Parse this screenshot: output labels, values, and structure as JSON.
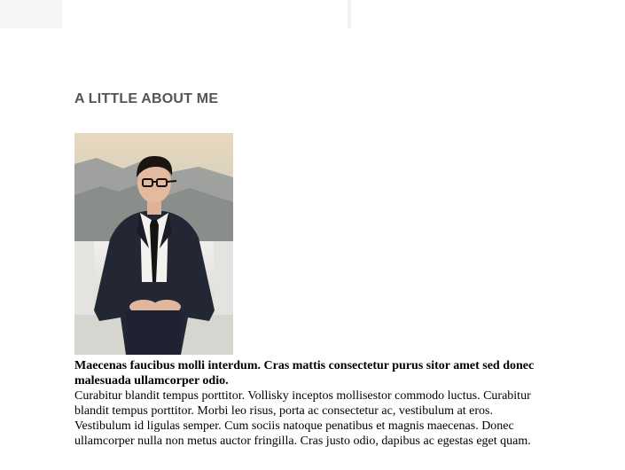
{
  "about": {
    "heading": "A LITTLE ABOUT ME",
    "lead": "Maecenas faucibus molli interdum. Cras mattis consectetur purus sitor amet sed donec malesuada ullamcorper odio.",
    "body": "Curabitur blandit tempus porttitor. Vollisky inceptos mollisestor commodo luctus. Curabitur blandit tempus porttitor. Morbi leo risus, porta ac consectetur ac, vestibulum at eros. Vestibulum id ligulas semper. Cum sociis natoque penatibus et magnis maecenas. Donec ullamcorper nulla non metus auctor fringilla. Cras justo odio, dapibus ac egestas eget quam."
  },
  "photo": {
    "icon": "profile-photo"
  }
}
